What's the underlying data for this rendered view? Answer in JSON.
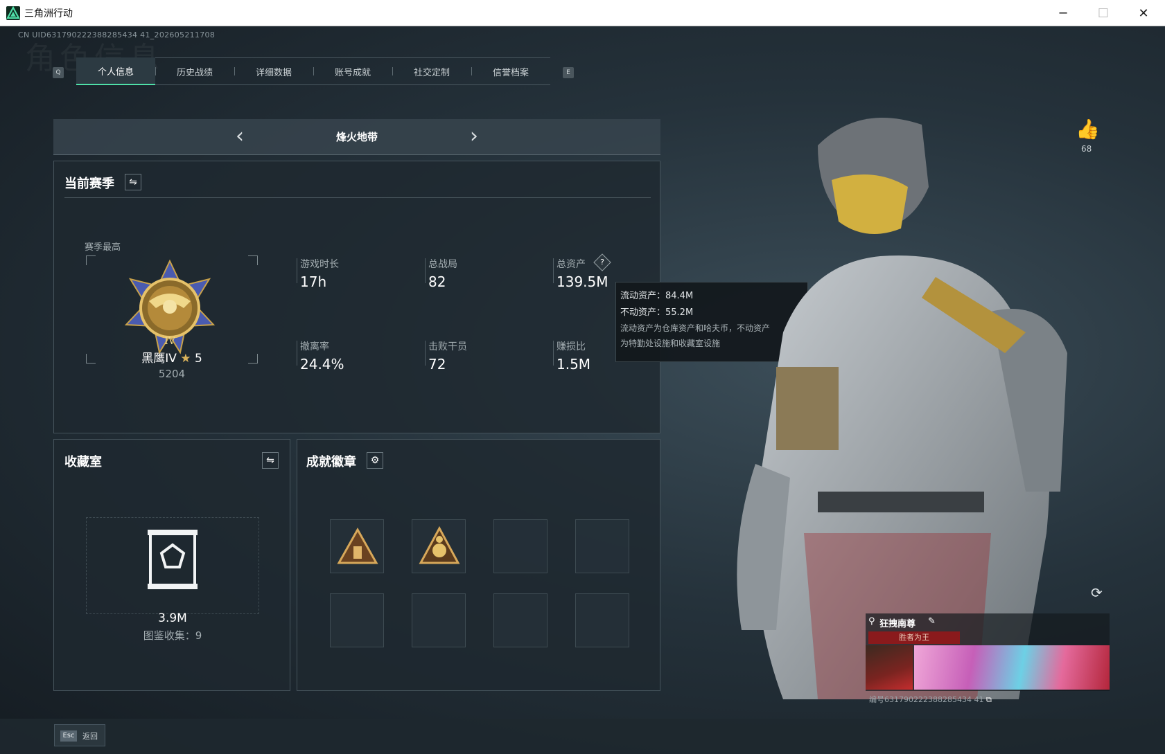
{
  "window": {
    "title": "三角洲行动",
    "minimize": "─",
    "maximize": "☐",
    "close": "✕"
  },
  "uid": "CN UID631790222388285434 41_202605211708",
  "tabs": {
    "prev_key": "Q",
    "next_key": "E",
    "items": [
      "个人信息",
      "历史战绩",
      "详细数据",
      "账号成就",
      "社交定制",
      "信誉档案"
    ],
    "active": "个人信息"
  },
  "mode": {
    "label": "烽火地带",
    "prev": "‹",
    "next": "›"
  },
  "season": {
    "title": "当前赛季",
    "best_label": "赛季最高",
    "rank": "黑鹰IV",
    "rank_stars": "5",
    "rank_score": "5204",
    "stats": [
      {
        "label": "游戏时长",
        "value": "17h"
      },
      {
        "label": "总战局",
        "value": "82"
      },
      {
        "label": "总资产",
        "value": "139.5M"
      },
      {
        "label": "撤离率",
        "value": "24.4%"
      },
      {
        "label": "击败干员",
        "value": "72"
      },
      {
        "label": "赚损比",
        "value": "1.5M"
      }
    ]
  },
  "tooltip": {
    "liquid": "流动资产：84.4M",
    "fixed": "不动资产：55.2M",
    "desc1": "流动资产为仓库资产和哈夫币，不动资产",
    "desc2": "为特勤处设施和收藏室设施"
  },
  "collection": {
    "title": "收藏室",
    "value": "3.9M",
    "count": "图鉴收集：9"
  },
  "badges": {
    "title": "成就徽章"
  },
  "profile": {
    "likes": "68",
    "name": "狂拽南尊",
    "banner": "胜者为王",
    "id": "编号631790222388285434 41"
  },
  "footer": {
    "esc_key": "Esc",
    "esc_label": "返回"
  },
  "colors": {
    "accent": "#4fe0a8",
    "panel": "#1e282f",
    "medal_gold": "#c9a24a",
    "medal_blue": "#4a5bb0"
  }
}
